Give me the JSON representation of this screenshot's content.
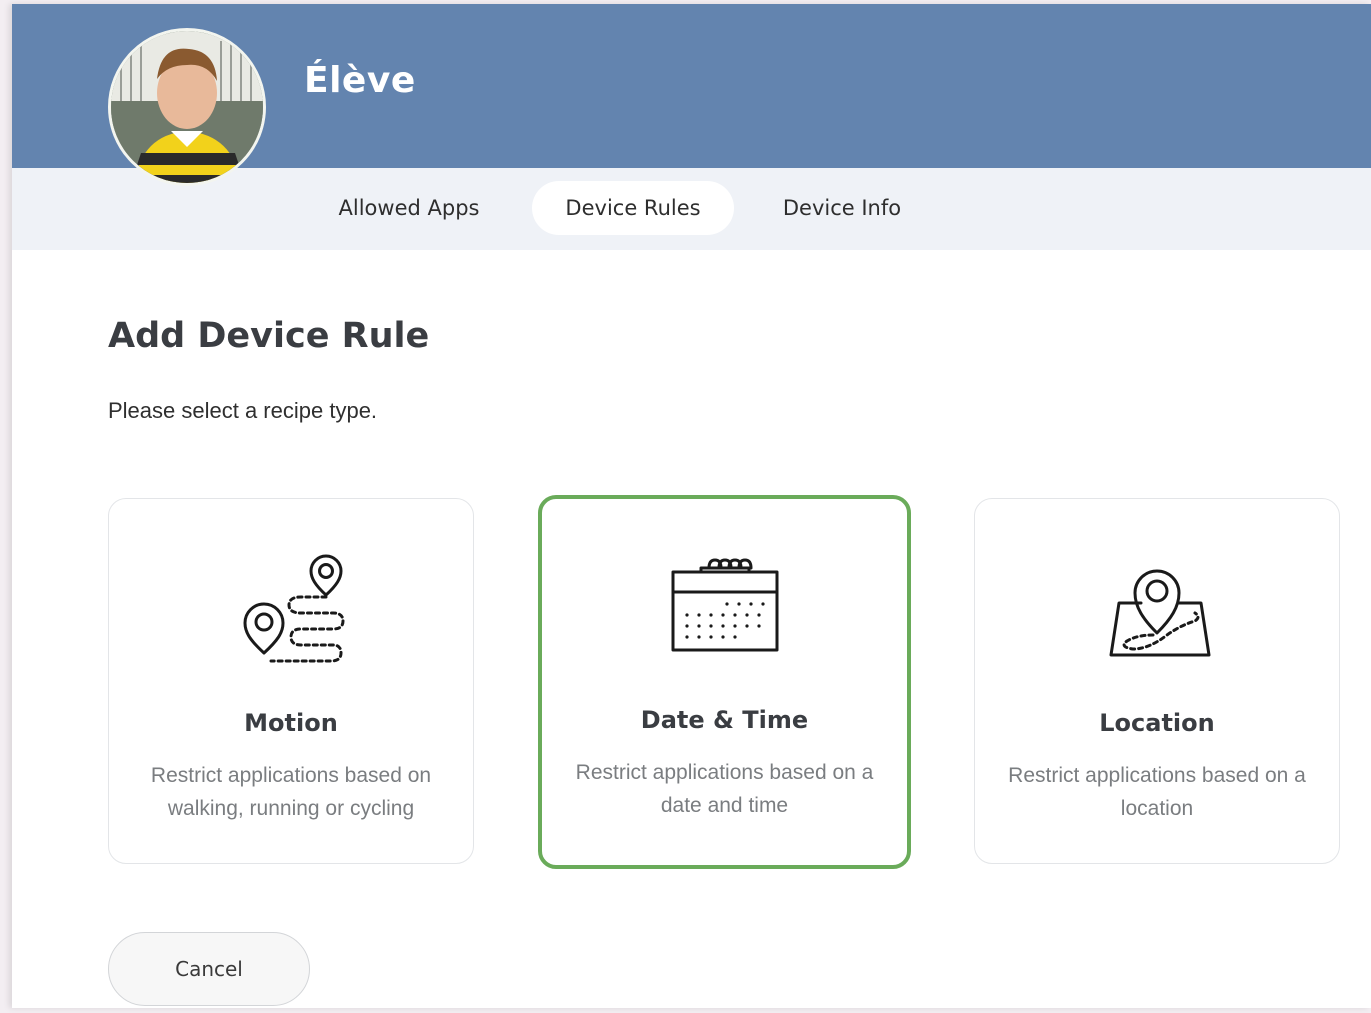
{
  "profile": {
    "name": "Élève"
  },
  "tabs": [
    {
      "label": "Allowed Apps",
      "active": false
    },
    {
      "label": "Device Rules",
      "active": true
    },
    {
      "label": "Device Info",
      "active": false
    }
  ],
  "main": {
    "title": "Add Device Rule",
    "instructions": "Please select a recipe type.",
    "recipes": [
      {
        "title": "Motion",
        "description": "Restrict applications based on walking, running or cycling",
        "icon": "motion-route-icon",
        "selected": false
      },
      {
        "title": "Date & Time",
        "description": "Restrict applications based on a date and time",
        "icon": "calendar-icon",
        "selected": true
      },
      {
        "title": "Location",
        "description": "Restrict applications based on a location",
        "icon": "map-pin-icon",
        "selected": false
      }
    ],
    "cancel_label": "Cancel"
  },
  "colors": {
    "header": "#6384af",
    "tab_bar": "#eff2f7",
    "selected_border": "#6aab5a",
    "title_text": "#3a3d42",
    "muted_text": "#7a7d80"
  }
}
